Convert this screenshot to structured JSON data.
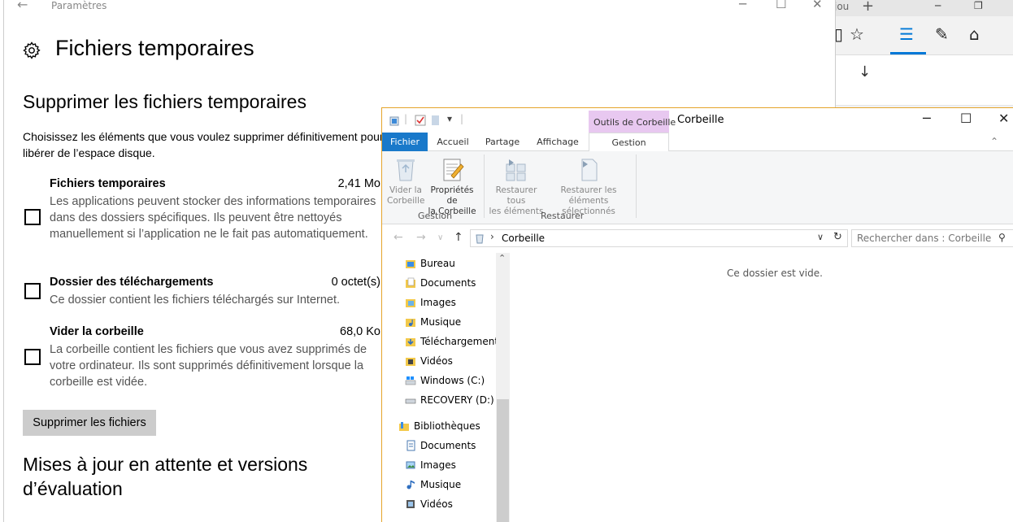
{
  "edge": {
    "tab_label": "jou"
  },
  "settings": {
    "app_title": "Paramètres",
    "page_title": "Fichiers temporaires",
    "section_title": "Supprimer les fichiers temporaires",
    "section_desc": "Choisissez les éléments que vous voulez supprimer définitivement pour libérer de l’espace disque.",
    "items": [
      {
        "title": "Fichiers temporaires",
        "size": "2,41 Mo",
        "desc": "Les applications peuvent stocker des informations temporaires dans des dossiers spécifiques. Ils peuvent être nettoyés manuellement si l’application ne le fait pas automatiquement.",
        "checked": false
      },
      {
        "title": "Dossier des téléchargements",
        "size": "0 octet(s)",
        "desc": "Ce dossier contient les fichiers téléchargés sur Internet.",
        "checked": false
      },
      {
        "title": "Vider la corbeille",
        "size": "68,0 Ko",
        "desc": "La corbeille contient les fichiers que vous avez supprimés de votre ordinateur. Ils sont supprimés définitivement lorsque la corbeille est vidée.",
        "checked": false
      }
    ],
    "delete_button": "Supprimer les fichiers",
    "next_section_title": "Mises à jour en attente et versions d’évaluation"
  },
  "explorer": {
    "contextual_tab": "Outils de Corbeille",
    "window_title": "Corbeille",
    "tabs": {
      "file": "Fichier",
      "home": "Accueil",
      "share": "Partage",
      "view": "Affichage",
      "manage": "Gestion"
    },
    "ribbon": {
      "empty_bin_line1": "Vider la",
      "empty_bin_line2": "Corbeille",
      "props_line1": "Propriétés de",
      "props_line2": "la Corbeille",
      "group_manage": "Gestion",
      "restore_all_line1": "Restaurer tous",
      "restore_all_line2": "les éléments",
      "restore_sel_line1": "Restaurer les",
      "restore_sel_line2": "éléments sélectionnés",
      "group_restore": "Restaurer"
    },
    "address": "Corbeille",
    "search_placeholder": "Rechercher dans : Corbeille",
    "nav_items": [
      {
        "label": "Bureau",
        "icon": "desktop-folder-icon"
      },
      {
        "label": "Documents",
        "icon": "documents-folder-icon"
      },
      {
        "label": "Images",
        "icon": "images-folder-icon"
      },
      {
        "label": "Musique",
        "icon": "music-folder-icon"
      },
      {
        "label": "Téléchargements",
        "icon": "downloads-folder-icon"
      },
      {
        "label": "Vidéos",
        "icon": "videos-folder-icon"
      },
      {
        "label": "Windows (C:)",
        "icon": "windows-drive-icon"
      },
      {
        "label": "RECOVERY (D:)",
        "icon": "drive-icon"
      },
      {
        "label": "Bibliothèques",
        "icon": "libraries-icon"
      },
      {
        "label": "Documents",
        "icon": "documents-library-icon"
      },
      {
        "label": "Images",
        "icon": "images-library-icon"
      },
      {
        "label": "Musique",
        "icon": "music-library-icon"
      },
      {
        "label": "Vidéos",
        "icon": "videos-library-icon"
      }
    ],
    "empty_message": "Ce dossier est vide."
  },
  "colors": {
    "accent": "#0078d7",
    "file_tab": "#1979ca",
    "contextual": "#e8c8f0",
    "window_border": "#e5a42b"
  }
}
